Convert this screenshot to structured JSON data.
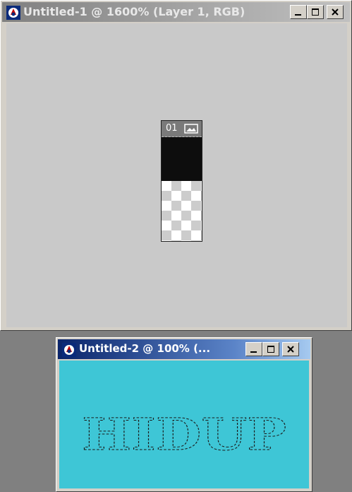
{
  "window1": {
    "title": "Untitled-1 @ 1600% (Layer 1, RGB)",
    "canvas_label": "01",
    "colors": {
      "canvas": "#c9c9c9",
      "fill": "#0d0d0d"
    }
  },
  "window2": {
    "title": "Untitled-2 @ 100% (...",
    "canvas_text": "HIDUP",
    "colors": {
      "canvas": "#3ec6d6"
    }
  },
  "controls": [
    "minimize-icon",
    "maximize-icon",
    "close-icon"
  ]
}
